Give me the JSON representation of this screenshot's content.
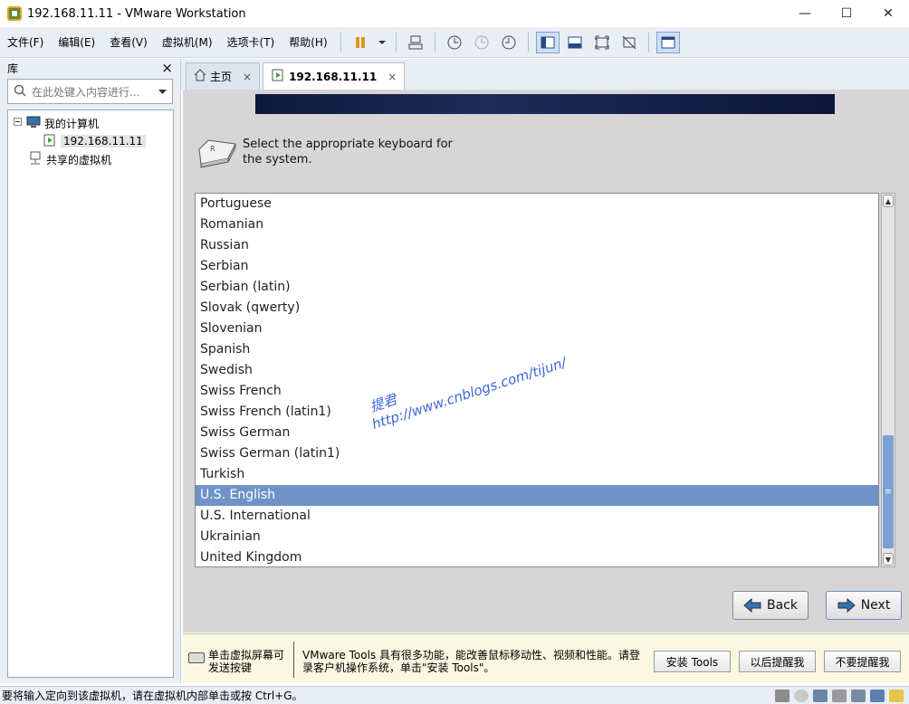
{
  "window": {
    "title": "192.168.11.11 - VMware Workstation",
    "minimize": "—",
    "maximize": "☐",
    "close": "✕"
  },
  "menu": {
    "items": [
      "文件(F)",
      "编辑(E)",
      "查看(V)",
      "虚拟机(M)",
      "选项卡(T)",
      "帮助(H)"
    ]
  },
  "library": {
    "title": "库",
    "close": "×",
    "search_placeholder": "在此处键入内容进行...",
    "tree": {
      "my_computer": "我的计算机",
      "vm": "192.168.11.11",
      "shared": "共享的虚拟机"
    }
  },
  "tabs": [
    {
      "label": "主页",
      "close": "×"
    },
    {
      "label": "192.168.11.11",
      "close": "×"
    }
  ],
  "installer": {
    "prompt": "Select the appropriate keyboard for the system.",
    "keyboards": [
      "Portuguese",
      "Romanian",
      "Russian",
      "Serbian",
      "Serbian (latin)",
      "Slovak (qwerty)",
      "Slovenian",
      "Spanish",
      "Swedish",
      "Swiss French",
      "Swiss French (latin1)",
      "Swiss German",
      "Swiss German (latin1)",
      "Turkish",
      "U.S. English",
      "U.S. International",
      "Ukrainian",
      "United Kingdom"
    ],
    "selected": "U.S. English",
    "back_label": "Back",
    "next_label": "Next"
  },
  "watermark": {
    "line1": "提君",
    "line2": "http://www.cnblogs.com/tijun/"
  },
  "notification": {
    "hint": "单击虚拟屏幕可发送按键",
    "message": "VMware Tools 具有很多功能，能改善鼠标移动性、视频和性能。请登录客户机操作系统，单击\"安装 Tools\"。",
    "install_label": "安装 Tools",
    "later_label": "以后提醒我",
    "never_label": "不要提醒我"
  },
  "status": {
    "text": "要将输入定向到该虚拟机，请在虚拟机内部单击或按 Ctrl+G。"
  }
}
